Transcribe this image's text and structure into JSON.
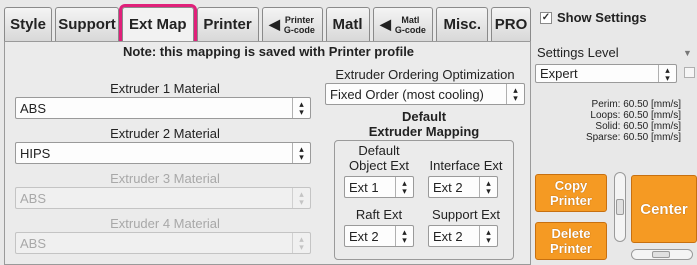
{
  "tabs": [
    {
      "label": "Style"
    },
    {
      "label": "Support"
    },
    {
      "label": "Ext Map"
    },
    {
      "label": "Printer"
    },
    {
      "label_top": "Printer",
      "label_bottom": "G-code"
    },
    {
      "label": "Matl"
    },
    {
      "label_top": "Matl",
      "label_bottom": "G-code"
    },
    {
      "label": "Misc."
    },
    {
      "label": "PRO"
    }
  ],
  "note": "Note: this mapping is saved with Printer profile",
  "extruders": [
    {
      "label": "Extruder 1 Material",
      "value": "ABS",
      "enabled": true
    },
    {
      "label": "Extruder 2 Material",
      "value": "HIPS",
      "enabled": true
    },
    {
      "label": "Extruder 3 Material",
      "value": "ABS",
      "enabled": false
    },
    {
      "label": "Extruder 4 Material",
      "value": "ABS",
      "enabled": false
    }
  ],
  "ordering": {
    "label": "Extruder Ordering Optimization",
    "value": "Fixed Order (most cooling)"
  },
  "default_mapping": {
    "title_line1": "Default",
    "title_line2": "Extruder Mapping",
    "object_ext": {
      "label_line1": "Default",
      "label_line2": "Object Ext",
      "value": "Ext 1"
    },
    "interface_ext": {
      "label": "Interface Ext",
      "value": "Ext 2"
    },
    "raft_ext": {
      "label": "Raft Ext",
      "value": "Ext 2"
    },
    "support_ext": {
      "label": "Support Ext",
      "value": "Ext 2"
    }
  },
  "right_panel": {
    "show_settings_label": "Show Settings",
    "show_settings_checked": true,
    "settings_level_label": "Settings Level",
    "settings_level_value": "Expert",
    "stats": [
      "Perim: 60.50 [mm/s]",
      "Loops: 60.50 [mm/s]",
      "Solid: 60.50 [mm/s]",
      "Sparse: 60.50 [mm/s]"
    ],
    "copy_printer_line1": "Copy",
    "copy_printer_line2": "Printer",
    "delete_printer_line1": "Delete",
    "delete_printer_line2": "Printer",
    "center_label": "Center"
  },
  "colors": {
    "active_tab_highlight": "#e0207a",
    "orange_button": "#f59a23"
  }
}
